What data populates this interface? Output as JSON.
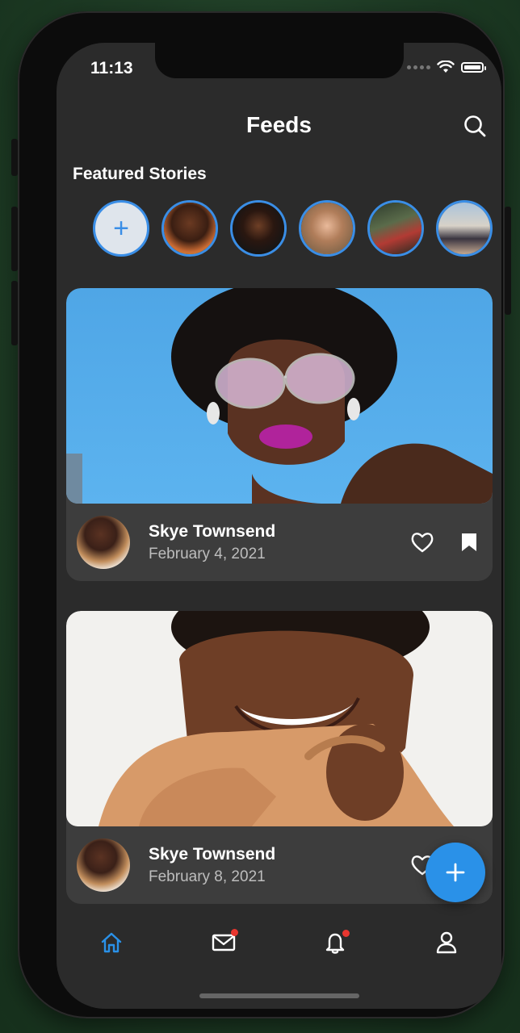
{
  "status_bar": {
    "time": "11:13"
  },
  "header": {
    "title": "Feeds"
  },
  "featured": {
    "heading": "Featured Stories",
    "add_label": "+",
    "story_count": 5
  },
  "posts": [
    {
      "author": "Skye Townsend",
      "date": "February 4, 2021"
    },
    {
      "author": "Skye Townsend",
      "date": "February 8, 2021"
    }
  ],
  "fab": {
    "label": "+"
  },
  "tabbar": {
    "items": [
      "home-icon",
      "mail-icon",
      "bell-icon",
      "profile-icon"
    ],
    "active": "home-icon"
  },
  "colors": {
    "accent": "#2a91e8",
    "background": "#2b2b2b",
    "card": "#3d3d3d",
    "badge": "#e8362f"
  }
}
